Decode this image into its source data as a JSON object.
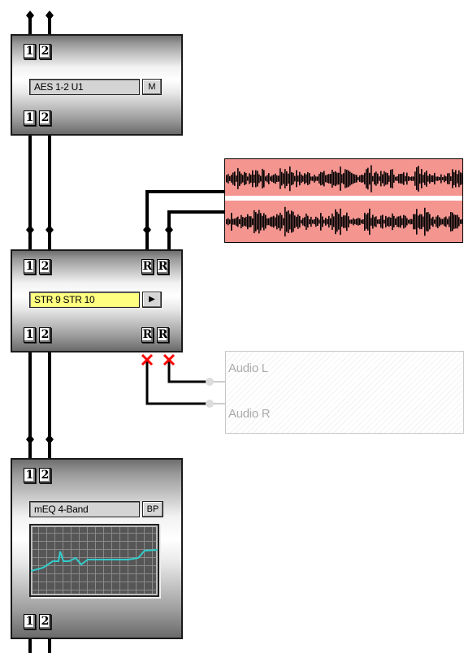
{
  "modules": {
    "aes": {
      "inputs": [
        "1",
        "2"
      ],
      "outputs": [
        "1",
        "2"
      ],
      "label": "AES 1-2 U1",
      "button": "M"
    },
    "stereo": {
      "inputs": [
        "1",
        "2"
      ],
      "return_inputs": [
        "R",
        "R"
      ],
      "outputs": [
        "1",
        "2"
      ],
      "return_outputs": [
        "R",
        "R"
      ],
      "label": "STR 9 STR 10",
      "button": "▶"
    },
    "eq": {
      "inputs": [
        "1",
        "2"
      ],
      "outputs": [
        "1",
        "2"
      ],
      "label": "mEQ 4-Band",
      "button": "BP"
    }
  },
  "aux_outputs": {
    "left": "Audio L",
    "right": "Audio R"
  },
  "colors": {
    "wire": "#000000",
    "disconnect_mark": "#ff0000",
    "label_highlight": "#ffff80",
    "waveform_background": "#f49590",
    "eq_curve": "#33cccc"
  }
}
